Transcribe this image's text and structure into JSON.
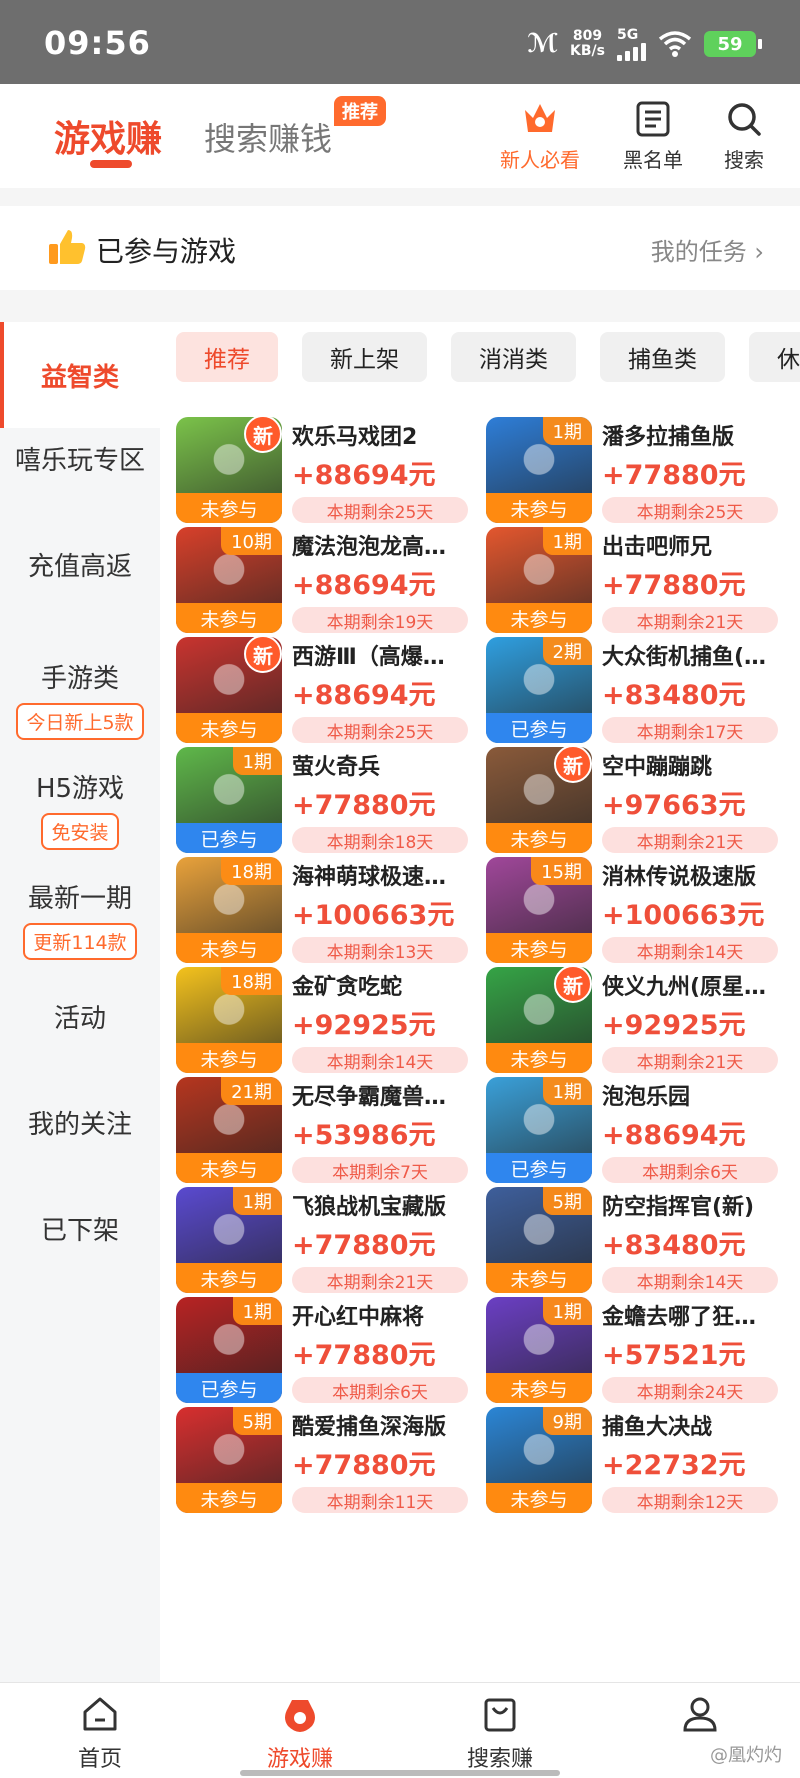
{
  "status_bar": {
    "time": "09:56",
    "net_speed_value": "809",
    "net_speed_unit": "KB/s",
    "network": "5G",
    "battery": "59"
  },
  "header": {
    "tab_main": "游戏赚",
    "tab_search": "搜索赚钱",
    "tab_search_badge": "推荐",
    "buttons": [
      {
        "label": "新人必看",
        "icon": "crown-star-icon"
      },
      {
        "label": "黑名单",
        "icon": "list-icon"
      },
      {
        "label": "搜索",
        "icon": "search-icon"
      }
    ]
  },
  "joined": {
    "label": "已参与游戏",
    "link": "我的任务 ›"
  },
  "sidebar": {
    "items": [
      {
        "label": "益智类"
      },
      {
        "label": "嘻乐玩专区"
      },
      {
        "label": "充值高返"
      },
      {
        "label": "手游类",
        "tag": "今日新上5款"
      },
      {
        "label": "H5游戏",
        "tag": "免安装"
      },
      {
        "label": "最新一期",
        "tag": "更新114款"
      },
      {
        "label": "活动"
      },
      {
        "label": "我的关注"
      },
      {
        "label": "已下架"
      }
    ]
  },
  "chips": [
    "推荐",
    "新上架",
    "消消类",
    "捕鱼类",
    "休"
  ],
  "games": [
    {
      "name": "欢乐马戏团2",
      "prize": "+88694元",
      "remain": "本期剩余25天",
      "period": "",
      "is_new": "新",
      "state": "未参与",
      "joined": false,
      "color": "#7bc34a"
    },
    {
      "name": "潘多拉捕鱼版",
      "prize": "+77880元",
      "remain": "本期剩余25天",
      "period": "1期",
      "is_new": "",
      "state": "未参与",
      "joined": false,
      "color": "#2e7ed8"
    },
    {
      "name": "魔法泡泡龙高…",
      "prize": "+88694元",
      "remain": "本期剩余19天",
      "period": "10期",
      "is_new": "",
      "state": "未参与",
      "joined": false,
      "color": "#d8402a"
    },
    {
      "name": "出击吧师兄",
      "prize": "+77880元",
      "remain": "本期剩余21天",
      "period": "1期",
      "is_new": "",
      "state": "未参与",
      "joined": false,
      "color": "#e4572e"
    },
    {
      "name": "西游Ⅲ（高爆…",
      "prize": "+88694元",
      "remain": "本期剩余25天",
      "period": "",
      "is_new": "新",
      "state": "未参与",
      "joined": false,
      "color": "#c9342f"
    },
    {
      "name": "大众街机捕鱼(…",
      "prize": "+83480元",
      "remain": "本期剩余17天",
      "period": "2期",
      "is_new": "",
      "state": "已参与",
      "joined": true,
      "color": "#2f9fe0"
    },
    {
      "name": "萤火奇兵",
      "prize": "+77880元",
      "remain": "本期剩余18天",
      "period": "1期",
      "is_new": "",
      "state": "已参与",
      "joined": true,
      "color": "#5fb84a"
    },
    {
      "name": "空中蹦蹦跳",
      "prize": "+97663元",
      "remain": "本期剩余21天",
      "period": "",
      "is_new": "新",
      "state": "未参与",
      "joined": false,
      "color": "#8a5a3a"
    },
    {
      "name": "海神萌球极速…",
      "prize": "+100663元",
      "remain": "本期剩余13天",
      "period": "18期",
      "is_new": "",
      "state": "未参与",
      "joined": false,
      "color": "#e9a23b"
    },
    {
      "name": "消林传说极速版",
      "prize": "+100663元",
      "remain": "本期剩余14天",
      "period": "15期",
      "is_new": "",
      "state": "未参与",
      "joined": false,
      "color": "#a0479a"
    },
    {
      "name": "金矿贪吃蛇",
      "prize": "+92925元",
      "remain": "本期剩余14天",
      "period": "18期",
      "is_new": "",
      "state": "未参与",
      "joined": false,
      "color": "#f4c21d"
    },
    {
      "name": "侠义九州(原星…",
      "prize": "+92925元",
      "remain": "本期剩余21天",
      "period": "",
      "is_new": "新",
      "state": "未参与",
      "joined": false,
      "color": "#35a446"
    },
    {
      "name": "无尽争霸魔兽…",
      "prize": "+53986元",
      "remain": "本期剩余7天",
      "period": "21期",
      "is_new": "",
      "state": "未参与",
      "joined": false,
      "color": "#b6361f"
    },
    {
      "name": "泡泡乐园",
      "prize": "+88694元",
      "remain": "本期剩余6天",
      "period": "1期",
      "is_new": "",
      "state": "已参与",
      "joined": true,
      "color": "#3aa0d9"
    },
    {
      "name": "飞狼战机宝藏版",
      "prize": "+77880元",
      "remain": "本期剩余21天",
      "period": "1期",
      "is_new": "",
      "state": "未参与",
      "joined": false,
      "color": "#5a4ad0"
    },
    {
      "name": "防空指挥官(新)",
      "prize": "+83480元",
      "remain": "本期剩余14天",
      "period": "5期",
      "is_new": "",
      "state": "未参与",
      "joined": false,
      "color": "#3e5f9c"
    },
    {
      "name": "开心红中麻将",
      "prize": "+77880元",
      "remain": "本期剩余6天",
      "period": "1期",
      "is_new": "",
      "state": "已参与",
      "joined": true,
      "color": "#b82323"
    },
    {
      "name": "金蟾去哪了狂…",
      "prize": "+57521元",
      "remain": "本期剩余24天",
      "period": "1期",
      "is_new": "",
      "state": "未参与",
      "joined": false,
      "color": "#6b3fc4"
    },
    {
      "name": "酷爱捕鱼深海版",
      "prize": "+77880元",
      "remain": "本期剩余11天",
      "period": "5期",
      "is_new": "",
      "state": "未参与",
      "joined": false,
      "color": "#d82f2f"
    },
    {
      "name": "捕鱼大决战",
      "prize": "+22732元",
      "remain": "本期剩余12天",
      "period": "9期",
      "is_new": "",
      "state": "未参与",
      "joined": false,
      "color": "#2b86d6"
    }
  ],
  "bottom_nav": [
    {
      "label": "首页",
      "icon": "home-icon"
    },
    {
      "label": "游戏赚",
      "icon": "game-bag-icon"
    },
    {
      "label": "搜索赚",
      "icon": "shopping-bag-icon"
    },
    {
      "label": "",
      "icon": "profile-icon"
    }
  ],
  "watermark": "@凰灼灼"
}
